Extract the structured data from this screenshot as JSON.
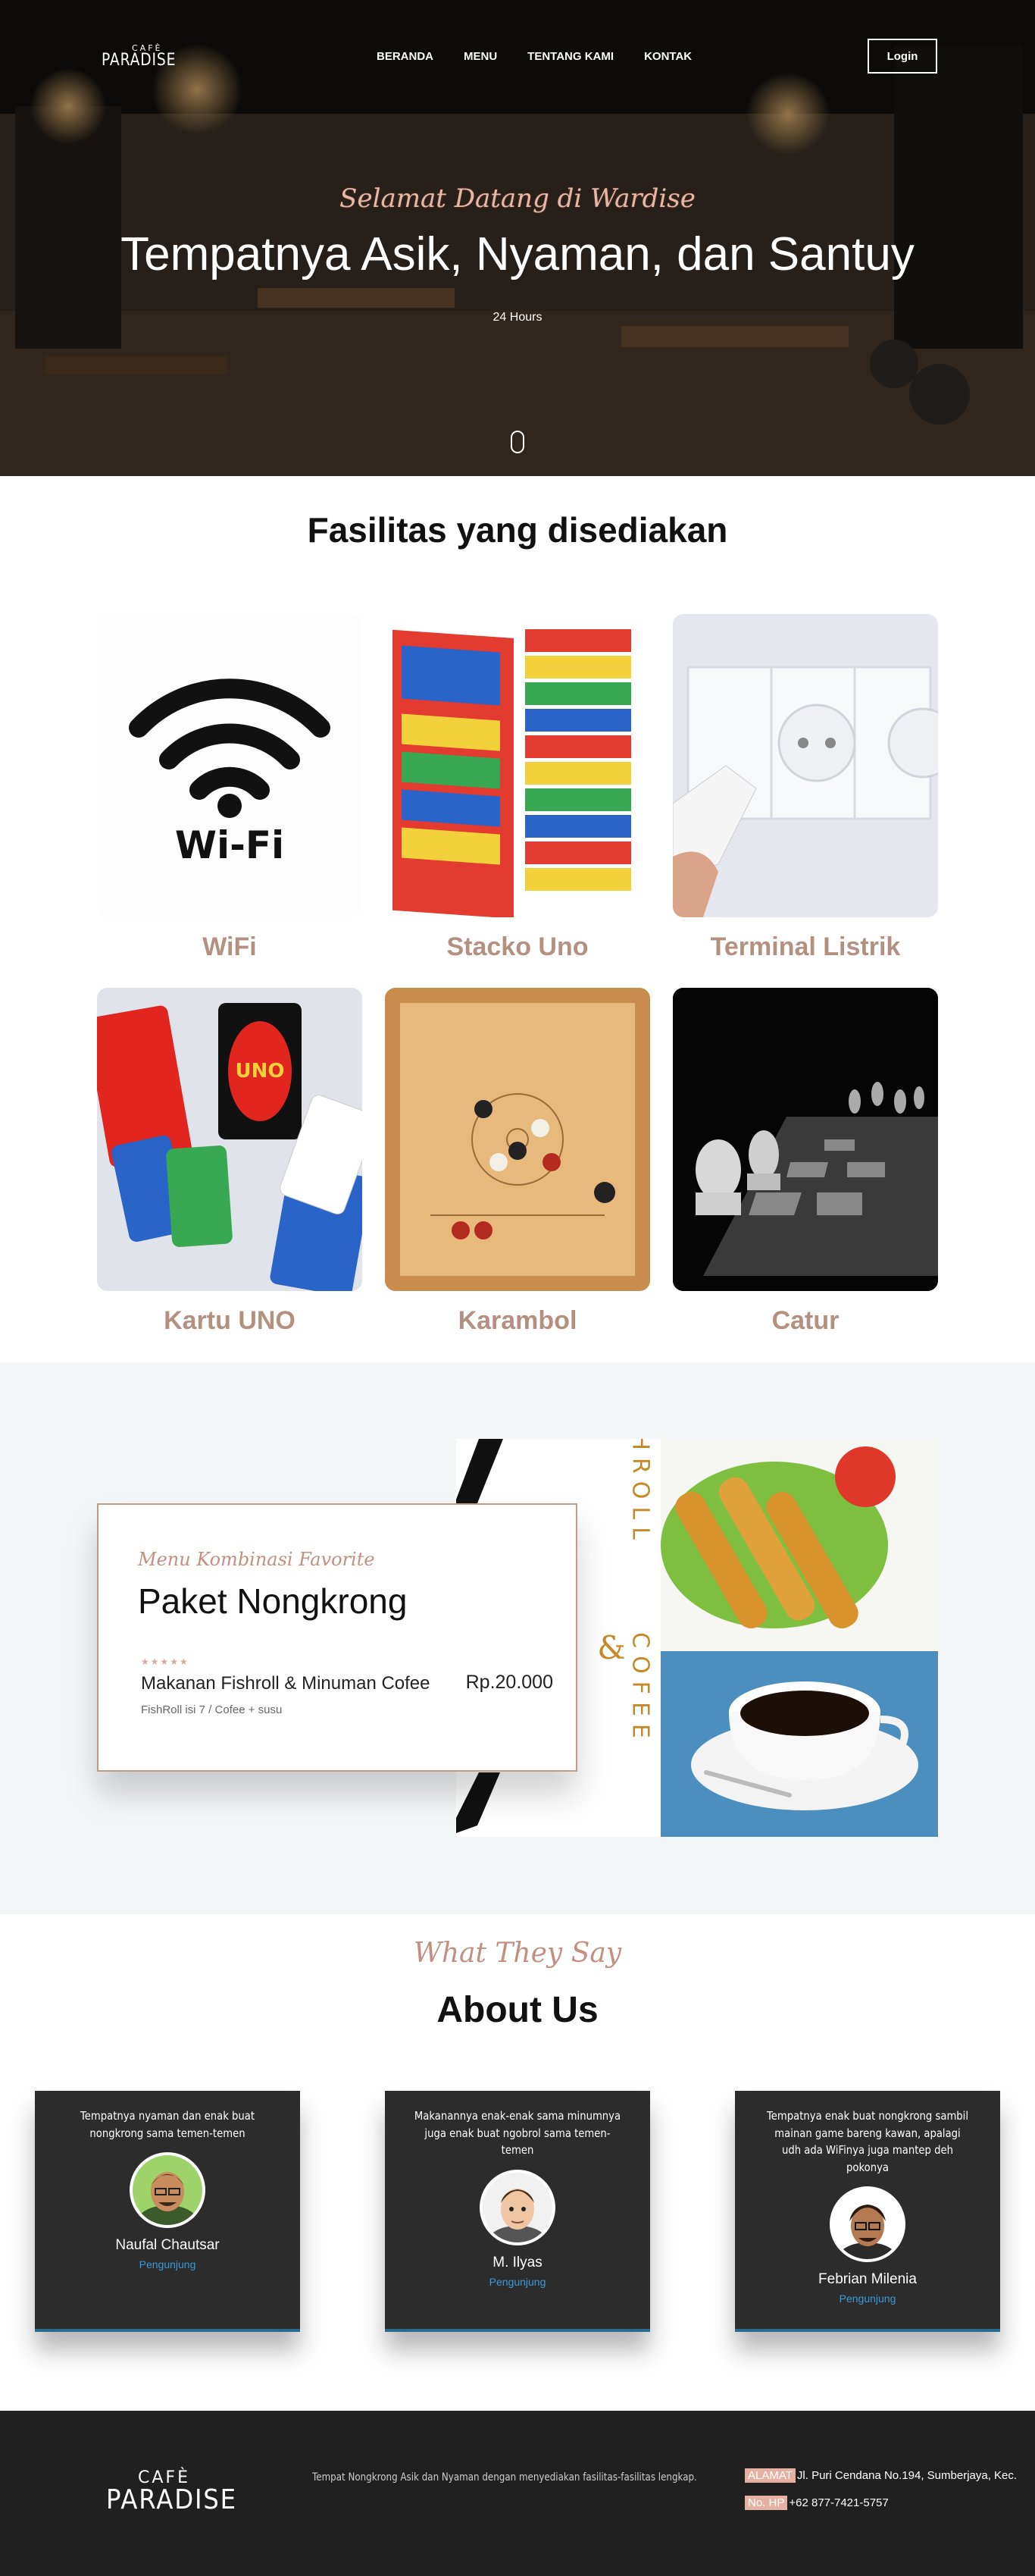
{
  "header": {
    "brand_small": "CAFÈ",
    "brand_big": "PARADISE",
    "nav": [
      "BERANDA",
      "MENU",
      "TENTANG KAMI",
      "KONTAK"
    ],
    "login_label": "Login"
  },
  "hero": {
    "welcome": "Selamat Datang di Wardise",
    "title": "Tempatnya Asik, Nyaman, dan Santuy",
    "hours": "24 Hours"
  },
  "facilities": {
    "title": "Fasilitas yang disediakan",
    "items": [
      {
        "label": "WiFi",
        "image": "wifi-icon"
      },
      {
        "label": "Stacko Uno",
        "image": "stacko-uno-photo"
      },
      {
        "label": "Terminal Listrik",
        "image": "power-socket-photo"
      },
      {
        "label": "Kartu UNO",
        "image": "uno-cards-photo"
      },
      {
        "label": "Karambol",
        "image": "carrom-board-photo"
      },
      {
        "label": "Catur",
        "image": "chess-photo"
      }
    ]
  },
  "menu": {
    "subtitle": "Menu Kombinasi Favorite",
    "name": "Paket Nongkrong",
    "stars": "★★★★★",
    "item": "Makanan Fishroll & Minuman Cofee",
    "price": "Rp.20.000",
    "desc": "FishRoll isi 7 / Cofee + susu",
    "art_text_1": "FISHROLL",
    "art_amp": "&",
    "art_text_2": "COFEE"
  },
  "about": {
    "subtitle": "What They Say",
    "title": "About Us",
    "testimonials": [
      {
        "quote": "Tempatnya nyaman dan enak buat nongkrong sama temen-temen",
        "name": "Naufal Chautsar",
        "role": "Pengunjung"
      },
      {
        "quote": "Makanannya enak-enak sama minumnya juga enak buat ngobrol sama temen-temen",
        "name": "M. Ilyas",
        "role": "Pengunjung"
      },
      {
        "quote": "Tempatnya enak buat nongkrong sambil mainan game bareng kawan, apalagi udh ada WiFinya juga mantep deh pokonya",
        "name": "Febrian Milenia",
        "role": "Pengunjung"
      }
    ]
  },
  "footer": {
    "brand_small": "CAFÈ",
    "brand_big": "PARADISE",
    "desc": "Tempat Nongkrong Asik dan Nyaman dengan menyediakan fasilitas-fasilitas lengkap.",
    "address_tag": "ALAMAT",
    "address": "Jl. Puri Cendana No.194, Sumberjaya, Kec.",
    "phone_tag": "No. HP",
    "phone": "+62 877-7421-5757"
  },
  "colors": {
    "accent": "#c48f81",
    "label": "#b49081",
    "footer_bg": "#202020",
    "card_bg": "#2c2c2c",
    "role": "#3a9ad9"
  }
}
